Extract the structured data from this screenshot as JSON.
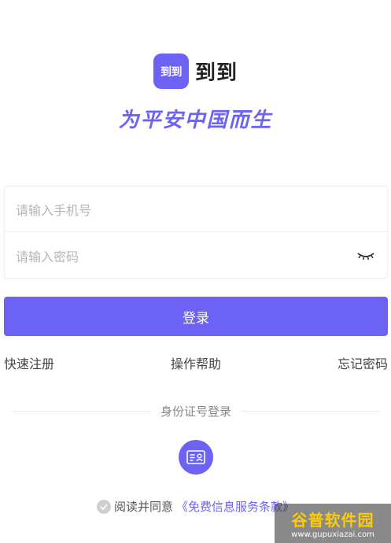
{
  "app": {
    "logo_badge_text": "到到",
    "name": "到到",
    "slogan": "为平安中国而生"
  },
  "form": {
    "phone_placeholder": "请输入手机号",
    "password_placeholder": "请输入密码",
    "password_toggle_icon": "eye-closed-icon"
  },
  "login_button": "登录",
  "links": {
    "register": "快速注册",
    "help": "操作帮助",
    "forgot": "忘记密码"
  },
  "alt_login": {
    "label": "身份证号登录",
    "icon": "id-card-icon"
  },
  "agreement": {
    "prefix": "阅读并同意",
    "terms": "《免费信息服务条款》"
  },
  "watermark": {
    "title": "谷普软件园",
    "url": "www.gupuxiazai.com"
  },
  "colors": {
    "accent": "#6c63f5"
  }
}
